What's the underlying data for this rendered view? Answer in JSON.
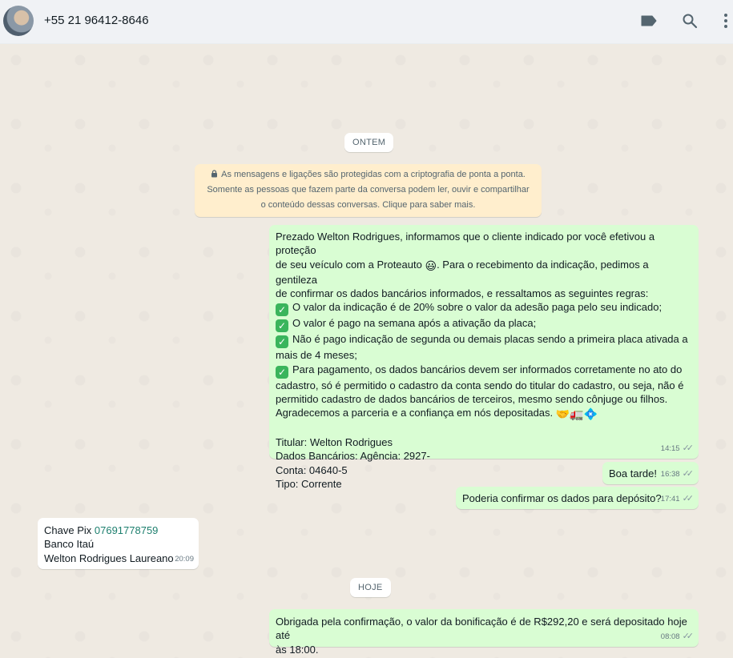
{
  "header": {
    "contact_name": "+55 21 96412-8646"
  },
  "chips": {
    "yesterday": "ONTEM",
    "today": "HOJE"
  },
  "encryption_notice": {
    "line1": "As mensagens e ligações são protegidas com a criptografia de ponta a ponta.",
    "line2": "Somente as pessoas que fazem parte da conversa podem ler, ouvir e compartilhar",
    "line3": "o conteúdo dessas conversas. Clique para saber mais."
  },
  "messages": {
    "m1": {
      "p1a": "Prezado Welton Rodrigues, informamos que o cliente indicado por você efetivou a proteção",
      "p1b": "de seu veículo com a Proteauto",
      "p1c": ". Para o recebimento da indicação, pedimos a gentileza",
      "p1d": "de confirmar os dados bancários informados, e  ressaltamos as seguintes regras:",
      "r1": "O valor da indicação é de 20% sobre o valor da adesão paga pelo seu indicado;",
      "r2": "O valor é pago na semana após a ativação da placa;",
      "r3a": "Não é pago indicação de segunda ou demais placas sendo a primeira placa ativada a",
      "r3b": "mais de 4 meses;",
      "r4a": "Para pagamento, os dados bancários devem ser informados corretamente no ato do",
      "r4b": "cadastro, só é permitido o cadastro da conta sendo do titular do cadastro, ou seja, não é",
      "r4c": "permitido cadastro de dados bancários de terceiros, mesmo sendo cônjuge ou filhos.",
      "thanks": "Agradecemos a parceria e a confiança em nós depositadas.",
      "holder": "Titular: Welton Rodrigues",
      "bank": "Dados Bancários: Agência: 2927-",
      "account": "Conta: 04640-5",
      "type": "Tipo: Corrente",
      "time": "14:15"
    },
    "m2": {
      "text": "Boa tarde!",
      "time": "16:38"
    },
    "m3": {
      "text": "Poderia confirmar os dados para depósito?",
      "time": "17:41"
    },
    "m4": {
      "pix_label": "Chave Pix ",
      "pix_value": "07691778759",
      "bank": "Banco Itaú",
      "name": "Welton Rodrigues Laureano",
      "time": "20:09"
    },
    "m5": {
      "line1": "Obrigada pela confirmação, o valor da bonificação é de R$292,20 e será depositado hoje até",
      "line2": "às 18:00.",
      "time": "08:08"
    }
  },
  "icons": {
    "label": "label-icon",
    "search": "search-icon",
    "menu": "kebab-menu-icon"
  }
}
